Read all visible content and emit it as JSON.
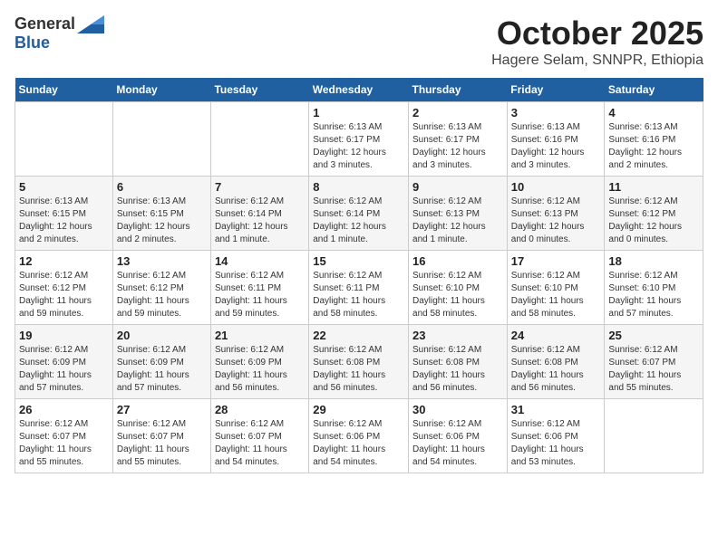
{
  "logo": {
    "general": "General",
    "blue": "Blue"
  },
  "title": "October 2025",
  "subtitle": "Hagere Selam, SNNPR, Ethiopia",
  "days_of_week": [
    "Sunday",
    "Monday",
    "Tuesday",
    "Wednesday",
    "Thursday",
    "Friday",
    "Saturday"
  ],
  "weeks": [
    [
      {
        "day": "",
        "info": ""
      },
      {
        "day": "",
        "info": ""
      },
      {
        "day": "",
        "info": ""
      },
      {
        "day": "1",
        "info": "Sunrise: 6:13 AM\nSunset: 6:17 PM\nDaylight: 12 hours\nand 3 minutes."
      },
      {
        "day": "2",
        "info": "Sunrise: 6:13 AM\nSunset: 6:17 PM\nDaylight: 12 hours\nand 3 minutes."
      },
      {
        "day": "3",
        "info": "Sunrise: 6:13 AM\nSunset: 6:16 PM\nDaylight: 12 hours\nand 3 minutes."
      },
      {
        "day": "4",
        "info": "Sunrise: 6:13 AM\nSunset: 6:16 PM\nDaylight: 12 hours\nand 2 minutes."
      }
    ],
    [
      {
        "day": "5",
        "info": "Sunrise: 6:13 AM\nSunset: 6:15 PM\nDaylight: 12 hours\nand 2 minutes."
      },
      {
        "day": "6",
        "info": "Sunrise: 6:13 AM\nSunset: 6:15 PM\nDaylight: 12 hours\nand 2 minutes."
      },
      {
        "day": "7",
        "info": "Sunrise: 6:12 AM\nSunset: 6:14 PM\nDaylight: 12 hours\nand 1 minute."
      },
      {
        "day": "8",
        "info": "Sunrise: 6:12 AM\nSunset: 6:14 PM\nDaylight: 12 hours\nand 1 minute."
      },
      {
        "day": "9",
        "info": "Sunrise: 6:12 AM\nSunset: 6:13 PM\nDaylight: 12 hours\nand 1 minute."
      },
      {
        "day": "10",
        "info": "Sunrise: 6:12 AM\nSunset: 6:13 PM\nDaylight: 12 hours\nand 0 minutes."
      },
      {
        "day": "11",
        "info": "Sunrise: 6:12 AM\nSunset: 6:12 PM\nDaylight: 12 hours\nand 0 minutes."
      }
    ],
    [
      {
        "day": "12",
        "info": "Sunrise: 6:12 AM\nSunset: 6:12 PM\nDaylight: 11 hours\nand 59 minutes."
      },
      {
        "day": "13",
        "info": "Sunrise: 6:12 AM\nSunset: 6:12 PM\nDaylight: 11 hours\nand 59 minutes."
      },
      {
        "day": "14",
        "info": "Sunrise: 6:12 AM\nSunset: 6:11 PM\nDaylight: 11 hours\nand 59 minutes."
      },
      {
        "day": "15",
        "info": "Sunrise: 6:12 AM\nSunset: 6:11 PM\nDaylight: 11 hours\nand 58 minutes."
      },
      {
        "day": "16",
        "info": "Sunrise: 6:12 AM\nSunset: 6:10 PM\nDaylight: 11 hours\nand 58 minutes."
      },
      {
        "day": "17",
        "info": "Sunrise: 6:12 AM\nSunset: 6:10 PM\nDaylight: 11 hours\nand 58 minutes."
      },
      {
        "day": "18",
        "info": "Sunrise: 6:12 AM\nSunset: 6:10 PM\nDaylight: 11 hours\nand 57 minutes."
      }
    ],
    [
      {
        "day": "19",
        "info": "Sunrise: 6:12 AM\nSunset: 6:09 PM\nDaylight: 11 hours\nand 57 minutes."
      },
      {
        "day": "20",
        "info": "Sunrise: 6:12 AM\nSunset: 6:09 PM\nDaylight: 11 hours\nand 57 minutes."
      },
      {
        "day": "21",
        "info": "Sunrise: 6:12 AM\nSunset: 6:09 PM\nDaylight: 11 hours\nand 56 minutes."
      },
      {
        "day": "22",
        "info": "Sunrise: 6:12 AM\nSunset: 6:08 PM\nDaylight: 11 hours\nand 56 minutes."
      },
      {
        "day": "23",
        "info": "Sunrise: 6:12 AM\nSunset: 6:08 PM\nDaylight: 11 hours\nand 56 minutes."
      },
      {
        "day": "24",
        "info": "Sunrise: 6:12 AM\nSunset: 6:08 PM\nDaylight: 11 hours\nand 56 minutes."
      },
      {
        "day": "25",
        "info": "Sunrise: 6:12 AM\nSunset: 6:07 PM\nDaylight: 11 hours\nand 55 minutes."
      }
    ],
    [
      {
        "day": "26",
        "info": "Sunrise: 6:12 AM\nSunset: 6:07 PM\nDaylight: 11 hours\nand 55 minutes."
      },
      {
        "day": "27",
        "info": "Sunrise: 6:12 AM\nSunset: 6:07 PM\nDaylight: 11 hours\nand 55 minutes."
      },
      {
        "day": "28",
        "info": "Sunrise: 6:12 AM\nSunset: 6:07 PM\nDaylight: 11 hours\nand 54 minutes."
      },
      {
        "day": "29",
        "info": "Sunrise: 6:12 AM\nSunset: 6:06 PM\nDaylight: 11 hours\nand 54 minutes."
      },
      {
        "day": "30",
        "info": "Sunrise: 6:12 AM\nSunset: 6:06 PM\nDaylight: 11 hours\nand 54 minutes."
      },
      {
        "day": "31",
        "info": "Sunrise: 6:12 AM\nSunset: 6:06 PM\nDaylight: 11 hours\nand 53 minutes."
      },
      {
        "day": "",
        "info": ""
      }
    ]
  ]
}
